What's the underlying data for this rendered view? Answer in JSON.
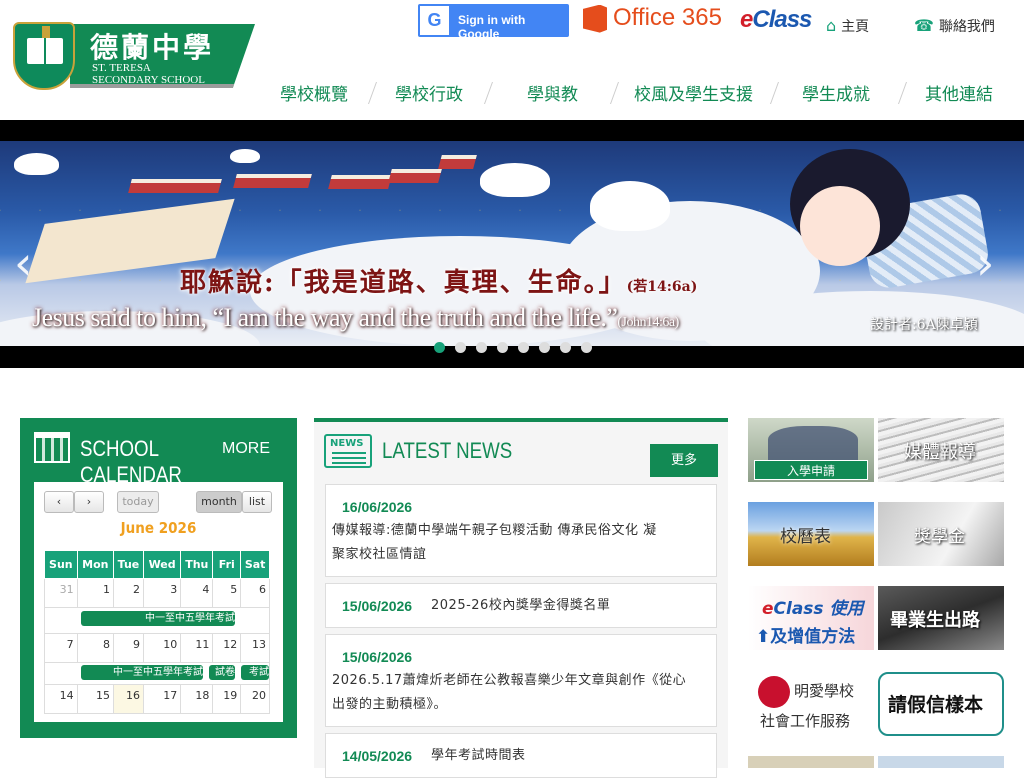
{
  "header": {
    "school_name_zh": "德蘭中學",
    "school_name_en_line1": "ST. TERESA",
    "school_name_en_line2": "SECONDARY SCHOOL",
    "google_signin": "Sign in with Google",
    "google_g": "G",
    "office": "Office 365",
    "eclass_e": "e",
    "eclass_rest": "Class",
    "home": "主頁",
    "contact": "聯絡我們"
  },
  "nav": [
    {
      "label": "學校概覽"
    },
    {
      "label": "學校行政"
    },
    {
      "label": "學與教"
    },
    {
      "label": "校風及學生支援"
    },
    {
      "label": "學生成就"
    },
    {
      "label": "其他連結"
    }
  ],
  "slider": {
    "verse_zh": "耶穌說:「我是道路、真理、生命。」",
    "verse_zh_ref": "(若14:6a)",
    "verse_en": "Jesus said to him, “I am the way and the truth and the life.”",
    "verse_en_ref": "(John14:6a)",
    "designer": "設計者:6A陳卓穎",
    "prev_arrow": "‹",
    "next_arrow": "›",
    "dots": 8,
    "active_dot": 0
  },
  "calendar": {
    "title": "SCHOOL CALENDAR",
    "more": "MORE",
    "prev": "‹",
    "next": "›",
    "today_btn": "today",
    "month_btn": "month",
    "list_btn": "list",
    "month": "June 2026",
    "days": [
      "Sun",
      "Mon",
      "Tue",
      "Wed",
      "Thu",
      "Fri",
      "Sat"
    ],
    "weeks": [
      [
        "31",
        "1",
        "2",
        "3",
        "4",
        "5",
        "6"
      ],
      [
        "7",
        "8",
        "9",
        "10",
        "11",
        "12",
        "13"
      ],
      [
        "14",
        "15",
        "16",
        "17",
        "18",
        "19",
        "20"
      ]
    ],
    "events": {
      "week1": "中一至中五學年考試",
      "week2": "中一至中五學年考試",
      "week2_fri": "試卷",
      "week2_sat": "考試"
    }
  },
  "news": {
    "badge": "NEWS",
    "title": "LATEST NEWS",
    "more": "更多",
    "items": [
      {
        "date": "16/06/2026",
        "title_l1": "傳媒報導:德蘭中學端午親子包糉活動 傳承民俗文化 凝",
        "title_l2": "聚家校社區情誼"
      },
      {
        "date": "15/06/2026",
        "title_l1": "2025-26校內獎學金得獎名單",
        "title_l2": ""
      },
      {
        "date": "15/06/2026",
        "title_l1": "2026.5.17蕭煒炘老師在公教報喜樂少年文章與創作《從心",
        "title_l2": "出發的主動積極》。"
      },
      {
        "date": "14/05/2026",
        "title_l1": "學年考試時間表",
        "title_l2": ""
      }
    ]
  },
  "side": {
    "admission": "入學申請",
    "media": "媒體報導",
    "school_calendar": "校曆表",
    "scholarship": "獎學金",
    "eclass_line1_e": "e",
    "eclass_line1_rest": "Class 使用",
    "eclass_line2": "及增值方法",
    "graduate": "畢業生出路",
    "caritas_line1": "明愛學校",
    "caritas_line2": "社會工作服務",
    "leave": "請假信樣本"
  },
  "colors": {
    "primary": "#128a54",
    "accent": "#18a27a",
    "month_title": "#f0a020"
  }
}
